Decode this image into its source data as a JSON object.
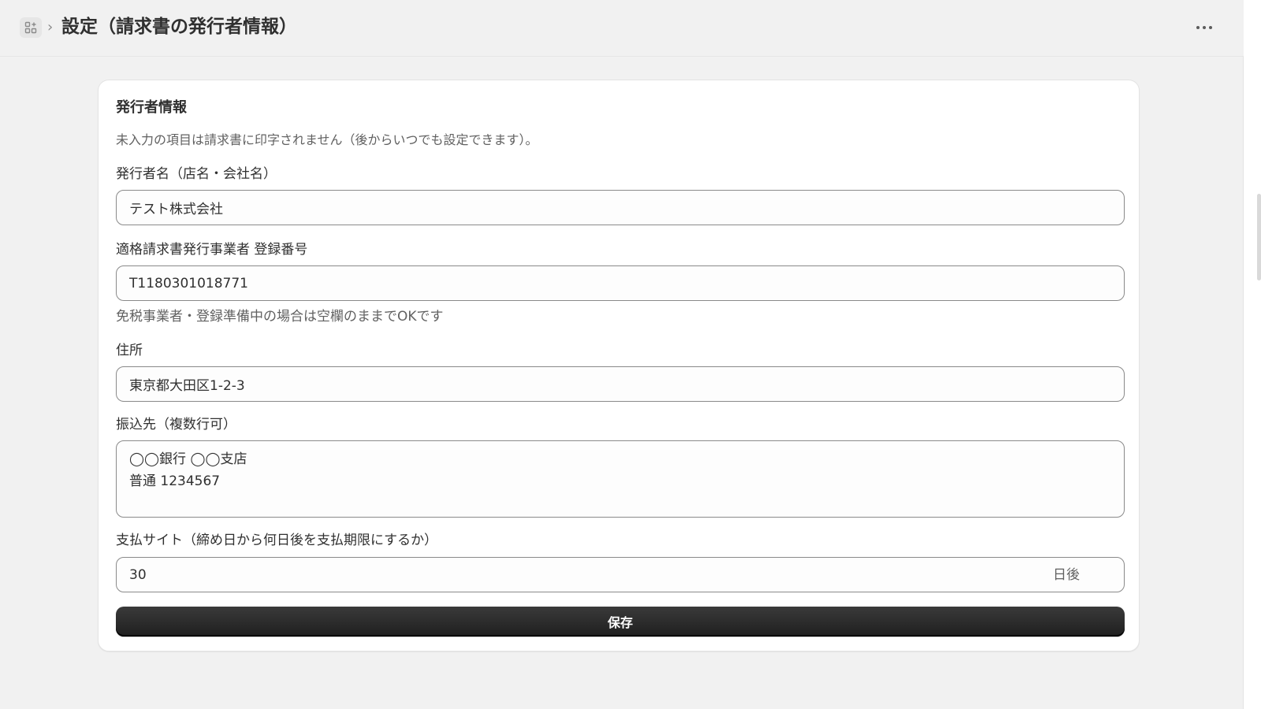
{
  "header": {
    "title": "設定（請求書の発行者情報）",
    "breadcrumb_separator": "›",
    "apps_icon": "apps-icon",
    "more_icon": "more-horizontal-icon"
  },
  "form": {
    "section_title": "発行者情報",
    "intro_note": "未入力の項目は請求書に印字されません（後からいつでも設定できます）。",
    "issuer_name": {
      "label": "発行者名（店名・会社名）",
      "value": "テスト株式会社"
    },
    "registration_number": {
      "label": "適格請求書発行事業者 登録番号",
      "value": "T1180301018771",
      "help": "免税事業者・登録準備中の場合は空欄のままでOKです"
    },
    "address": {
      "label": "住所",
      "value": "東京都大田区1-2-3"
    },
    "bank_account": {
      "label": "振込先（複数行可）",
      "value": "◯◯銀行 ◯◯支店\n普通 1234567"
    },
    "payment_terms": {
      "label": "支払サイト（締め日から何日後を支払期限にするか）",
      "value": "30",
      "suffix": "日後"
    },
    "save_label": "保存"
  },
  "colors": {
    "background": "#f1f1f1",
    "card": "#ffffff",
    "primary_button": "#2a2a2a",
    "text": "#303030",
    "muted_text": "#616161"
  }
}
